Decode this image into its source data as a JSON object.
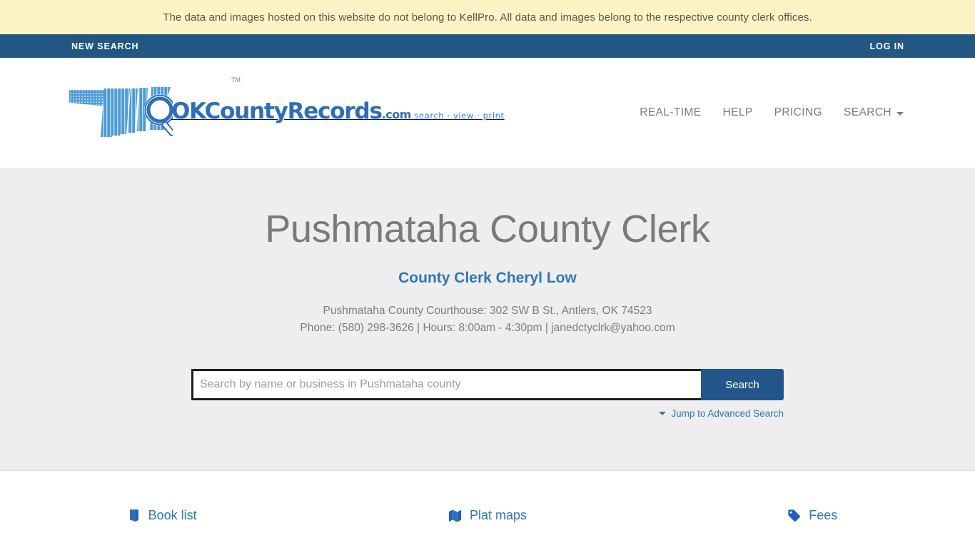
{
  "disclaimer": {
    "text": "The data and images hosted on this website do not belong to KellPro. All data and images belong to the respective county clerk offices."
  },
  "utility_bar": {
    "new_search_label": "NEW SEARCH",
    "log_in_label": "LOG IN",
    "background_color": "#215780"
  },
  "logo": {
    "wordmark_ok": "OK",
    "wordmark_rest": "CountyRecords",
    "wordmark_dotcom": ".com",
    "trademark": "TM",
    "tagline": "search · view · print",
    "color": "#2d6fb7"
  },
  "nav": {
    "items": [
      {
        "label": "REAL-TIME",
        "has_caret": false
      },
      {
        "label": "HELP",
        "has_caret": false
      },
      {
        "label": "PRICING",
        "has_caret": false
      },
      {
        "label": "SEARCH",
        "has_caret": true
      }
    ]
  },
  "hero": {
    "title": "Pushmataha County Clerk",
    "clerk_name": "County Clerk Cheryl Low",
    "address_line1": "Pushmataha County Courthouse: 302 SW B St., Antlers, OK 74523",
    "address_line2": "Phone: (580) 298-3626 | Hours: 8:00am - 4:30pm | janedctyclrk@yahoo.com",
    "background_color": "#eeeeee"
  },
  "search": {
    "placeholder": "Search by name or business in Pushmataha county",
    "value": "",
    "button_label": "Search",
    "advanced_label": "Jump to Advanced Search",
    "button_color": "#22568a"
  },
  "quick_links": [
    {
      "label": "Book list",
      "icon": "book-icon"
    },
    {
      "label": "Plat maps",
      "icon": "map-icon"
    },
    {
      "label": "Fees",
      "icon": "tag-icon"
    }
  ]
}
